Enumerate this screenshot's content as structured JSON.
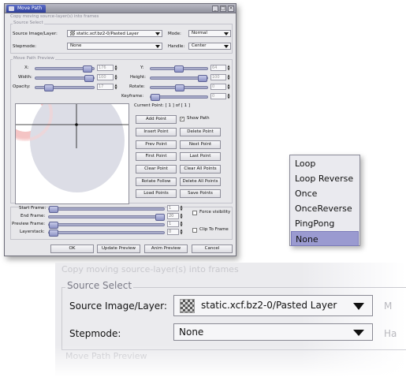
{
  "window": {
    "title": "Move Path",
    "top_caption": "Copy moving source-layer(s) into frames"
  },
  "source_select": {
    "legend": "Source Select",
    "source_label": "Source Image/Layer:",
    "source_value": "static.xcf.bz2-0/Pasted Layer",
    "mode_label": "Mode:",
    "mode_value": "Normal",
    "stepmode_label": "Stepmode:",
    "stepmode_value": "None",
    "handle_label": "Handle:",
    "handle_value": "Center"
  },
  "preview": {
    "legend": "Move Path Preview",
    "x_label": "X:",
    "x_value": "176",
    "y_label": "Y:",
    "y_value": "64",
    "width_label": "Width:",
    "width_value": "100",
    "height_label": "Height:",
    "height_value": "100",
    "opacity_label": "Opacity:",
    "opacity_value": "17",
    "rotate_label": "Rotate:",
    "rotate_value": "0",
    "keyframe_label": "Keyframe:",
    "keyframe_value": "0",
    "current_point": "Current Point: [  1 ] of [  1 ]",
    "show_path_label": "Show Path",
    "buttons": [
      "Add Point",
      "Insert Point",
      "Prev Point",
      "First Point",
      "Clear Point",
      "Rotate Follow",
      "Load Points"
    ],
    "buttons_right": [
      "Delete Point",
      "Next Point",
      "Last Point",
      "Clear All Points",
      "Delete All Points",
      "Save Points"
    ]
  },
  "frames": {
    "start_label": "Start Frame:",
    "start_value": "1",
    "end_label": "End Frame:",
    "end_value": "20",
    "preview_label": "Preview Frame:",
    "preview_value": "1",
    "layerstack_label": "Layerstack:",
    "layerstack_value": "0",
    "force_visibility": "Force visibility",
    "clip_to_frame": "Clip To Frame"
  },
  "bottom_buttons": {
    "ok": "OK",
    "update_preview": "Update Preview",
    "anim_preview": "Anim Preview",
    "cancel": "Cancel"
  },
  "stepmode_menu": {
    "items": [
      "Loop",
      "Loop Reverse",
      "Once",
      "OnceReverse",
      "PingPong",
      "None"
    ],
    "selected": "None"
  },
  "zoom": {
    "caption": "Copy moving source-layer(s) into frames",
    "legend": "Source Select",
    "source_label": "Source Image/Layer:",
    "source_value": "static.xcf.bz2-0/Pasted Layer",
    "stepmode_label": "Stepmode:",
    "stepmode_value": "None",
    "mode_cut": "M",
    "handle_cut": "Ha",
    "preview_legend": "Move Path Preview"
  },
  "colors": {
    "title_active": "#3a4ba8",
    "slider": "#a9acc9",
    "menu_selected": "#9a9ad0"
  }
}
